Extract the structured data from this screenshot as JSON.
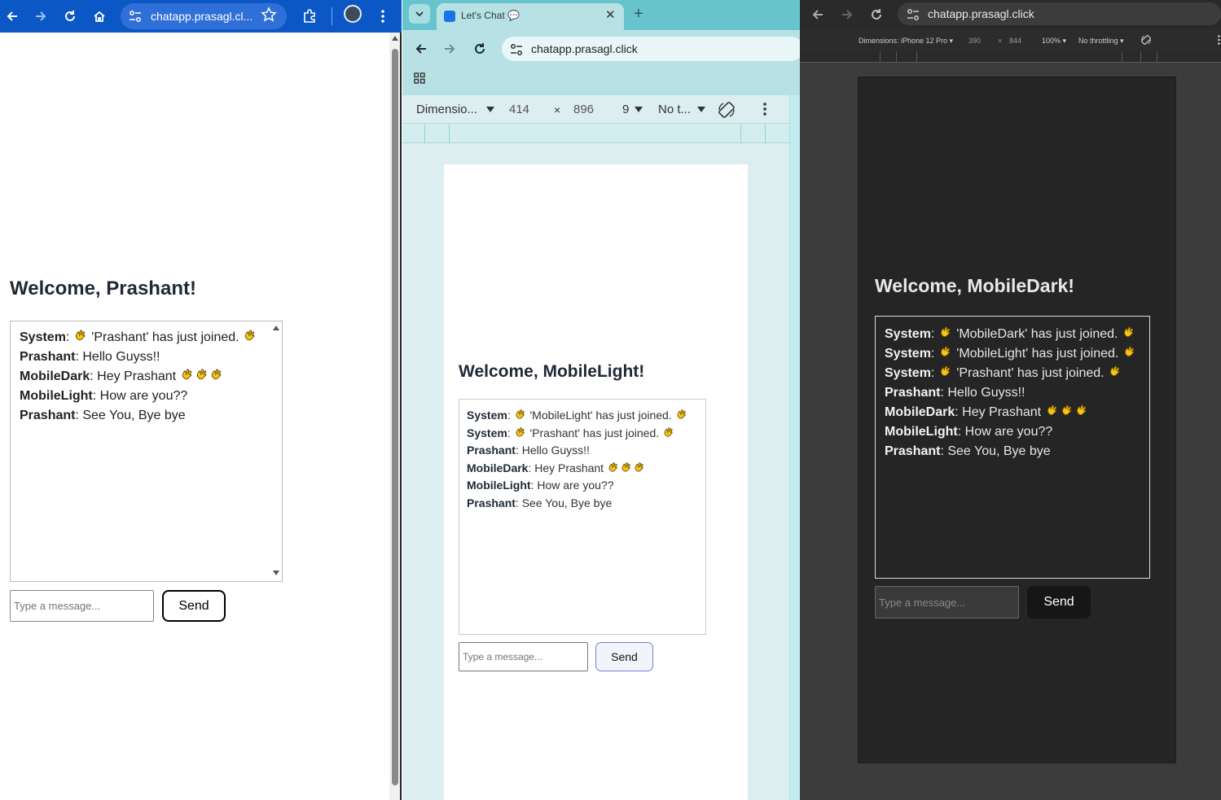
{
  "windows": {
    "left": {
      "url": "chatapp.prasagl.cl...",
      "app": {
        "welcome": "Welcome, Prashant!",
        "placeholder": "Type a message...",
        "send": "Send",
        "messages": [
          {
            "user": "System",
            "text": " 'Prashant' has just joined. ",
            "claps_before": 1,
            "claps_after": 1
          },
          {
            "user": "Prashant",
            "text": "Hello Guyss!!",
            "claps_before": 0,
            "claps_after": 0
          },
          {
            "user": "MobileDark",
            "text": "Hey Prashant ",
            "claps_before": 0,
            "claps_after": 3
          },
          {
            "user": "MobileLight",
            "text": "How are you??",
            "claps_before": 0,
            "claps_after": 0
          },
          {
            "user": "Prashant",
            "text": "See You, Bye bye",
            "claps_before": 0,
            "claps_after": 0
          }
        ]
      }
    },
    "middle": {
      "tab_title": "Let's Chat 💬",
      "url": "chatapp.prasagl.click",
      "devtools": {
        "dimensions": "Dimensio...",
        "width": "414",
        "height": "896",
        "zoom": "9",
        "throttle": "No t..."
      },
      "app": {
        "welcome": "Welcome, MobileLight!",
        "placeholder": "Type a message...",
        "send": "Send",
        "messages": [
          {
            "user": "System",
            "text": " 'MobileLight' has just joined. ",
            "claps_before": 1,
            "claps_after": 1
          },
          {
            "user": "System",
            "text": " 'Prashant' has just joined. ",
            "claps_before": 1,
            "claps_after": 1
          },
          {
            "user": "Prashant",
            "text": "Hello Guyss!!",
            "claps_before": 0,
            "claps_after": 0
          },
          {
            "user": "MobileDark",
            "text": "Hey Prashant ",
            "claps_before": 0,
            "claps_after": 3
          },
          {
            "user": "MobileLight",
            "text": "How are you??",
            "claps_before": 0,
            "claps_after": 0
          },
          {
            "user": "Prashant",
            "text": "See You, Bye bye",
            "claps_before": 0,
            "claps_after": 0
          }
        ]
      }
    },
    "right": {
      "url": "chatapp.prasagl.click",
      "devtools": {
        "dimensions": "Dimensions: iPhone 12 Pro ▾",
        "width": "390",
        "times": "×",
        "height": "844",
        "zoom": "100% ▾",
        "throttle": "No throttling ▾"
      },
      "app": {
        "welcome": "Welcome, MobileDark!",
        "placeholder": "Type a message...",
        "send": "Send",
        "messages": [
          {
            "user": "System",
            "text": " 'MobileDark' has just joined. ",
            "claps_before": 1,
            "claps_after": 1
          },
          {
            "user": "System",
            "text": " 'MobileLight' has just joined. ",
            "claps_before": 1,
            "claps_after": 1
          },
          {
            "user": "System",
            "text": " 'Prashant' has just joined. ",
            "claps_before": 1,
            "claps_after": 1
          },
          {
            "user": "Prashant",
            "text": "Hello Guyss!!",
            "claps_before": 0,
            "claps_after": 0
          },
          {
            "user": "MobileDark",
            "text": "Hey Prashant ",
            "claps_before": 0,
            "claps_after": 3
          },
          {
            "user": "MobileLight",
            "text": "How are you??",
            "claps_before": 0,
            "claps_after": 0
          },
          {
            "user": "Prashant",
            "text": "See You, Bye bye",
            "claps_before": 0,
            "claps_after": 0
          }
        ]
      }
    }
  },
  "colors": {
    "left_toolbar": "#0b57c6",
    "middle_theme": "#67c4cd",
    "dark_bg": "#252525",
    "clap_yellow": "#f5c518"
  },
  "icons": [
    "back-icon",
    "forward-icon",
    "reload-icon",
    "home-icon",
    "tune-icon",
    "star-icon",
    "extensions-icon",
    "menu-icon",
    "apps-icon",
    "rotate-icon",
    "clapping-hands-icon",
    "waving-hand-icon"
  ]
}
